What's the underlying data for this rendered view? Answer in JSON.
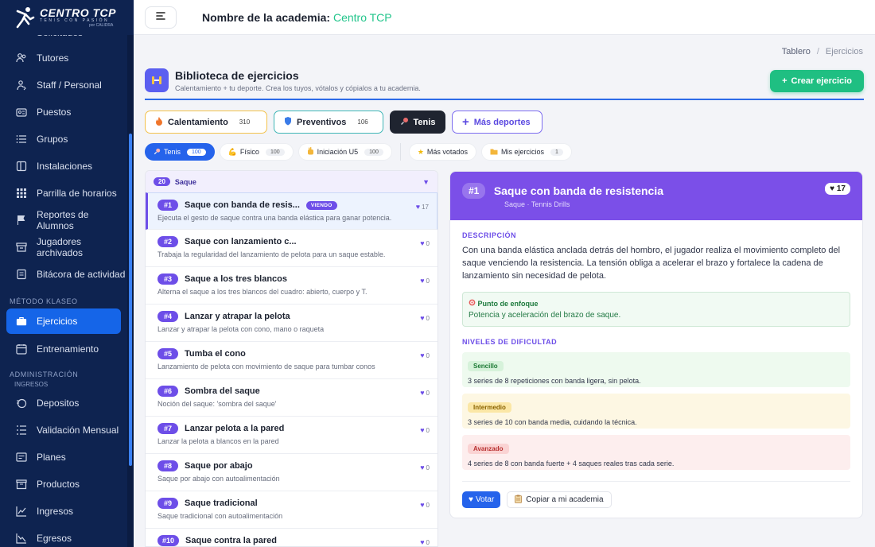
{
  "brand": {
    "title": "CENTRO TCP",
    "subtitle": "TENIS CON PASIÓN",
    "by": "por CALIDRA"
  },
  "sidebar": {
    "partial_label": "Solicitudes",
    "items": [
      {
        "label": "Tutores",
        "icon": "users-icon"
      },
      {
        "label": "Staff / Personal",
        "icon": "staff-icon"
      },
      {
        "label": "Puestos",
        "icon": "id-card-icon"
      },
      {
        "label": "Grupos",
        "icon": "list-icon"
      },
      {
        "label": "Instalaciones",
        "icon": "building-icon"
      },
      {
        "label": "Parrilla de horarios",
        "icon": "grid-icon"
      },
      {
        "label": "Reportes de Alumnos",
        "icon": "flag-icon"
      },
      {
        "label": "Jugadores archivados",
        "icon": "archive-icon"
      },
      {
        "label": "Bitácora de actividad",
        "icon": "log-icon"
      }
    ],
    "section_metodo": "MÉTODO KLASEO",
    "metodo_items": [
      {
        "label": "Ejercicios",
        "icon": "briefcase-icon",
        "active": true
      },
      {
        "label": "Entrenamiento",
        "icon": "calendar-icon"
      }
    ],
    "section_admin": "ADMINISTRACIÓN",
    "sub_ingresos": "INGRESOS",
    "admin_items": [
      {
        "label": "Depositos",
        "icon": "deposit-icon"
      },
      {
        "label": "Validación Mensual",
        "icon": "checklist-icon"
      },
      {
        "label": "Planes",
        "icon": "plans-icon"
      },
      {
        "label": "Productos",
        "icon": "box-icon"
      },
      {
        "label": "Ingresos",
        "icon": "chart-up-icon"
      },
      {
        "label": "Egresos",
        "icon": "chart-down-icon"
      }
    ]
  },
  "topbar": {
    "academy_label": "Nombre de la academia:",
    "academy_name": "Centro TCP"
  },
  "breadcrumb": {
    "root": "Tablero",
    "sep": "/",
    "current": "Ejercicios"
  },
  "header": {
    "title": "Biblioteca de ejercicios",
    "subtitle": "Calentamiento + tu deporte. Crea los tuyos, vótalos y cópialos a tu academia.",
    "create_label": "Crear ejercicio"
  },
  "sport_tabs": [
    {
      "label": "Calentamiento",
      "count": "310",
      "icon": "fire-icon"
    },
    {
      "label": "Preventivos",
      "count": "106",
      "icon": "shield-icon"
    },
    {
      "label": "Tenis",
      "count": "",
      "icon": "racket-icon"
    },
    {
      "label": "Más deportes",
      "count": "",
      "icon": "plus-icon"
    }
  ],
  "filters": [
    {
      "label": "Tenis",
      "count": "100",
      "icon": "racket-icon",
      "active": true
    },
    {
      "label": "Físico",
      "count": "100",
      "icon": "muscle-icon"
    },
    {
      "label": "Iniciación U5",
      "count": "100",
      "icon": "hand-icon"
    },
    {
      "label": "Más votados",
      "count": "",
      "icon": "star-icon"
    },
    {
      "label": "Mis ejercicios",
      "count": "1",
      "icon": "folder-icon"
    }
  ],
  "list": {
    "group_count": "20",
    "group_name": "Saque",
    "viendo_label": "VIENDO",
    "rows": [
      {
        "num": "#1",
        "title": "Saque con banda de resis...",
        "desc": "Ejecuta el gesto de saque contra una banda elástica para ganar potencia.",
        "likes": "17",
        "selected": true
      },
      {
        "num": "#2",
        "title": "Saque con lanzamiento c...",
        "desc": "Trabaja la regularidad del lanzamiento de pelota para un saque estable.",
        "likes": "0"
      },
      {
        "num": "#3",
        "title": "Saque a los tres blancos",
        "desc": "Alterna el saque a los tres blancos del cuadro: abierto, cuerpo y T.",
        "likes": "0"
      },
      {
        "num": "#4",
        "title": "Lanzar y atrapar la pelota",
        "desc": "Lanzar y atrapar la pelota con cono, mano o raqueta",
        "likes": "0"
      },
      {
        "num": "#5",
        "title": "Tumba el cono",
        "desc": "Lanzamiento de pelota con movimiento de saque para tumbar conos",
        "likes": "0"
      },
      {
        "num": "#6",
        "title": "Sombra del saque",
        "desc": "Noción del saque: 'sombra del saque'",
        "likes": "0"
      },
      {
        "num": "#7",
        "title": "Lanzar pelota a la pared",
        "desc": "Lanzar la pelota a blancos en la pared",
        "likes": "0"
      },
      {
        "num": "#8",
        "title": "Saque por abajo",
        "desc": "Saque por abajo con autoalimentación",
        "likes": "0"
      },
      {
        "num": "#9",
        "title": "Saque tradicional",
        "desc": "Saque tradicional con autoalimentación",
        "likes": "0"
      },
      {
        "num": "#10",
        "title": "Saque contra la pared",
        "desc": "",
        "likes": "0"
      }
    ]
  },
  "detail": {
    "num": "#1",
    "title": "Saque con banda de resistencia",
    "meta": "Saque · Tennis Drills",
    "likes": "17",
    "desc_label": "DESCRIPCIÓN",
    "desc": "Con una banda elástica anclada detrás del hombro, el jugador realiza el movimiento completo del saque venciendo la resistencia. La tensión obliga a acelerar el brazo y fortalece la cadena de lanzamiento sin necesidad de pelota.",
    "focus_label": "Punto de enfoque",
    "focus_value": "Potencia y aceleración del brazo de saque.",
    "levels_label": "NIVELES DE DIFICULTAD",
    "levels": [
      {
        "name": "Sencillo",
        "text": "3 series de 8 repeticiones con banda ligera, sin pelota."
      },
      {
        "name": "Intermedio",
        "text": "3 series de 10 con banda media, cuidando la técnica."
      },
      {
        "name": "Avanzado",
        "text": "4 series de 8 con banda fuerte + 4 saques reales tras cada serie."
      }
    ],
    "vote_label": "Votar",
    "copy_label": "Copiar a mi academia"
  },
  "colors": {
    "accent": "#6d4ee8",
    "primary": "#2563eb",
    "success": "#1fbf82",
    "sidebar": "#0e2350"
  }
}
